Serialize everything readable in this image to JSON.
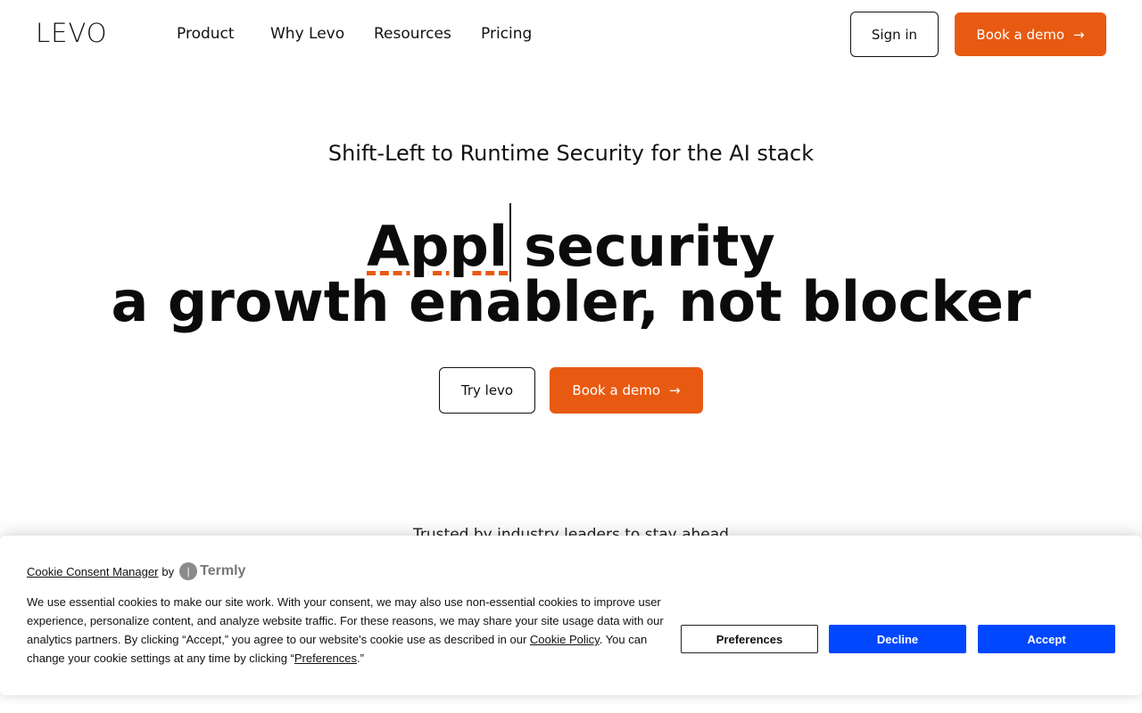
{
  "header": {
    "logo": "LEVO",
    "nav": [
      {
        "label": "Product"
      },
      {
        "label": "Why Levo"
      },
      {
        "label": "Resources"
      },
      {
        "label": "Pricing"
      }
    ],
    "sign_in": "Sign in",
    "book_demo": "Book a demo"
  },
  "hero": {
    "eyebrow": "Shift-Left to Runtime Security for the AI stack",
    "typed_word": "Appl",
    "headline_rest": "security",
    "headline_line2": "a growth enabler, not blocker",
    "try_button": "Try levo",
    "demo_button": "Book a demo",
    "trusted": "Trusted by industry leaders to stay ahead"
  },
  "cookie": {
    "manager_link": "Cookie Consent Manager",
    "by": "by",
    "brand": "Termly",
    "text_part1": "We use essential cookies to make our site work. With your consent, we may also use non-essential cookies to improve user experience, personalize content, and analyze website traffic. For these reasons, we may share your site usage data with our analytics partners. By clicking “Accept,” you agree to our website's cookie use as described in our ",
    "policy_link": "Cookie Policy",
    "text_part2": ". You can change your cookie settings at any time by clicking “",
    "preferences_link": "Preferences",
    "text_part3": ".”",
    "preferences_button": "Preferences",
    "decline_button": "Decline",
    "accept_button": "Accept"
  },
  "colors": {
    "accent": "#e85a12",
    "consent_blue": "#0047ff"
  }
}
